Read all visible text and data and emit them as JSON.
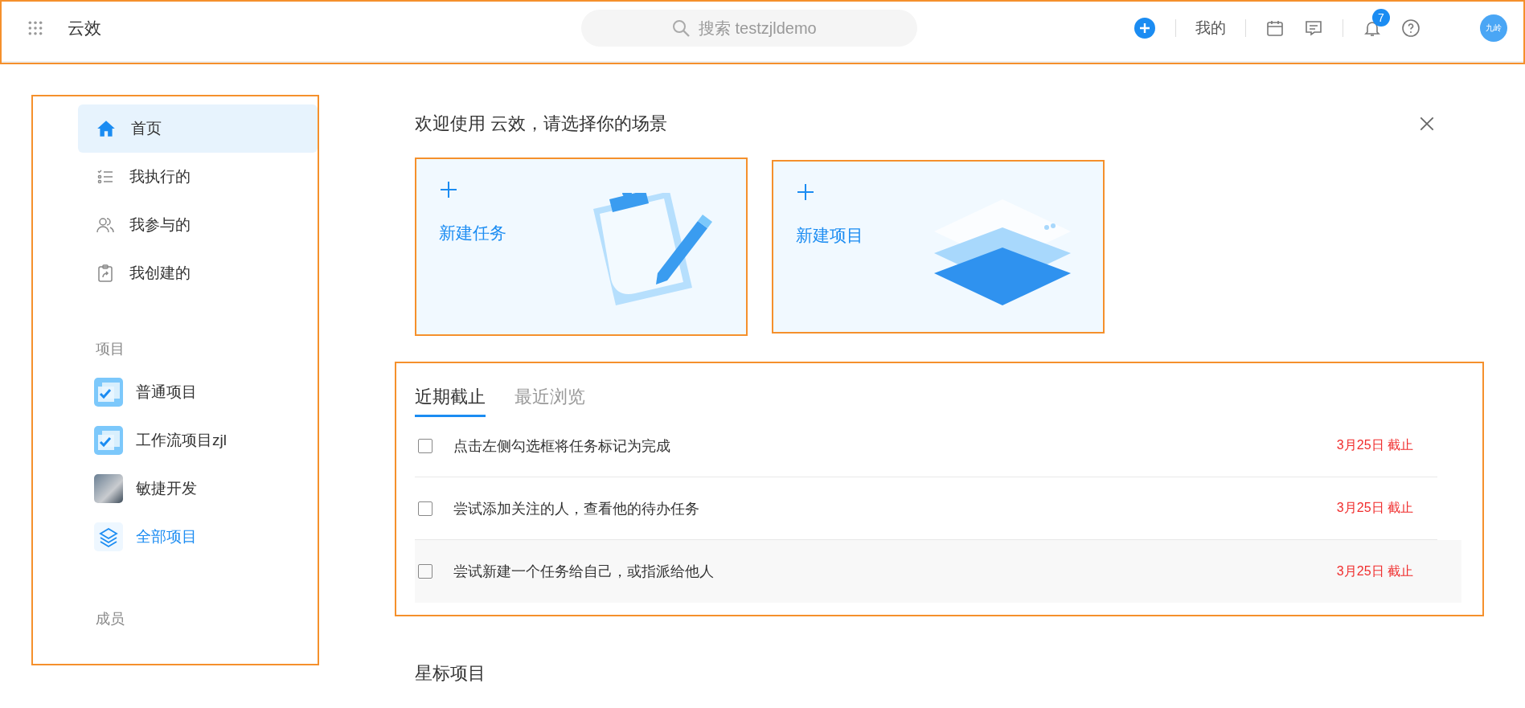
{
  "top_bar": {
    "app_name": "云效",
    "search": {
      "placeholder": "搜索 testzjldemo"
    },
    "my_label": "我的",
    "notification_badge": "7",
    "avatar_text": "九岭"
  },
  "sidebar": {
    "nav": [
      {
        "label": "首页",
        "kind": "home",
        "selected": true
      },
      {
        "label": "我执行的",
        "kind": "list",
        "selected": false
      },
      {
        "label": "我参与的",
        "kind": "people",
        "selected": false
      },
      {
        "label": "我创建的",
        "kind": "clipboard",
        "selected": false
      }
    ],
    "projects_heading": "项目",
    "projects": [
      {
        "label": "普通项目",
        "kind": "checklist"
      },
      {
        "label": "工作流项目zjl",
        "kind": "checklist"
      },
      {
        "label": "敏捷开发",
        "kind": "photo"
      },
      {
        "label": "全部项目",
        "kind": "all"
      }
    ],
    "members_heading": "成员"
  },
  "welcome": {
    "title": "欢迎使用 云效，请选择你的场景",
    "cards": [
      {
        "label": "新建任务",
        "kind": "task"
      },
      {
        "label": "新建项目",
        "kind": "project"
      }
    ]
  },
  "tasks": {
    "tabs": [
      {
        "label": "近期截止",
        "selected": true
      },
      {
        "label": "最近浏览",
        "selected": false
      }
    ],
    "rows": [
      {
        "text": "点击左侧勾选框将任务标记为完成",
        "due": "3月25日 截止",
        "checked": false,
        "hovered": false
      },
      {
        "text": "尝试添加关注的人，查看他的待办任务",
        "due": "3月25日 截止",
        "checked": false,
        "hovered": false
      },
      {
        "text": "尝试新建一个任务给自己，或指派给他人",
        "due": "3月25日 截止",
        "checked": false,
        "hovered": true
      }
    ]
  },
  "starred_heading": "星标项目"
}
